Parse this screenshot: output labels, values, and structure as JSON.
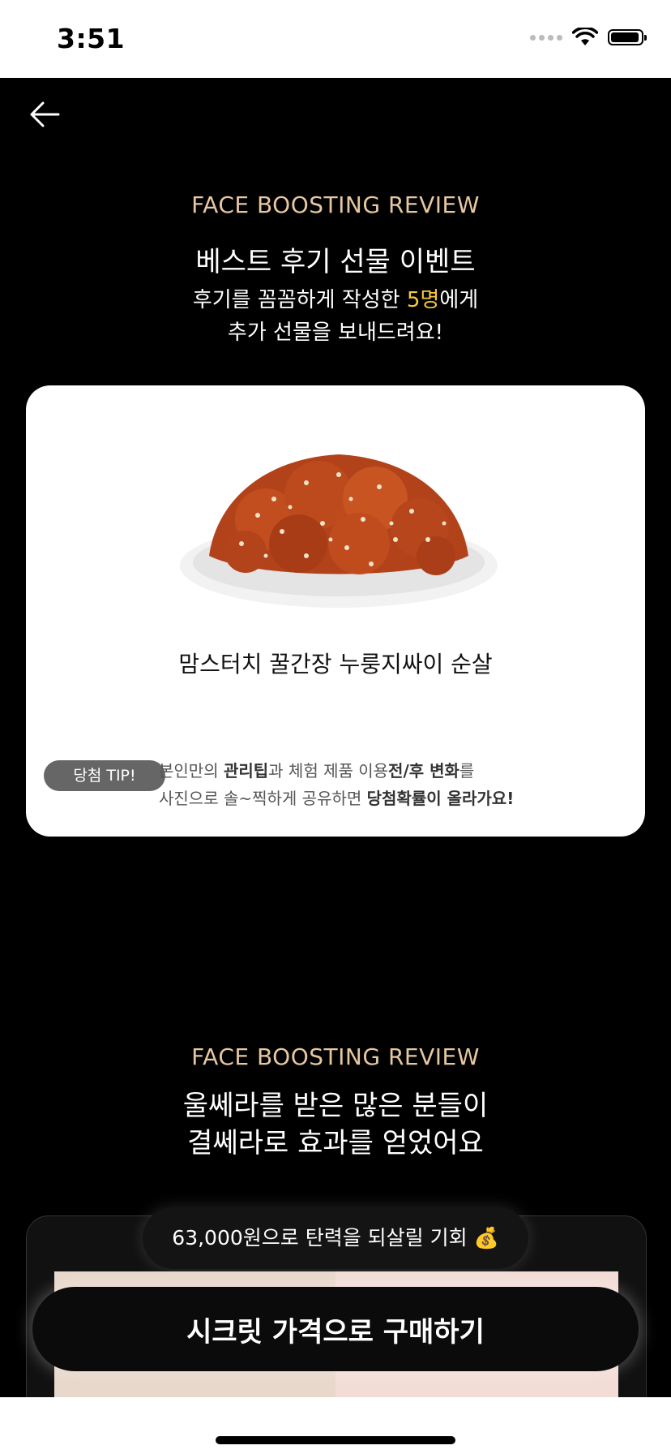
{
  "status_bar": {
    "time": "3:51"
  },
  "section1": {
    "eyebrow": "FACE BOOSTING REVIEW",
    "title": "베스트 후기 선물 이벤트",
    "subtitle_before": "후기를 꼼꼼하게 작성한 ",
    "subtitle_highlight": "5명",
    "subtitle_after": "에게",
    "subtitle_line2": "추가 선물을 보내드려요!",
    "highlight_color": "#f6c93a"
  },
  "card": {
    "product_name": "맘스터치 꿀간장 누룽지싸이 순살",
    "tip_badge": "당첨 TIP!",
    "tip_line1_a": "본인만의 ",
    "tip_line1_b": "관리팁",
    "tip_line1_c": "과 체험 제품 이용",
    "tip_line1_d": "전/후 변화",
    "tip_line1_e": "를",
    "tip_line2_a": "사진으로 솔~찍하게 공유하면 ",
    "tip_line2_b": "당첨확률이 올라가요!"
  },
  "section2": {
    "eyebrow": "FACE BOOSTING REVIEW",
    "title_line1": "울쎄라를 받은 많은 분들이",
    "title_line2": "결쎄라로 효과를 얻었어요"
  },
  "promo": {
    "chance_text": "63,000원으로 탄력을 되살릴 기회 💰",
    "buy_button": "시크릿 가격으로 구매하기"
  }
}
